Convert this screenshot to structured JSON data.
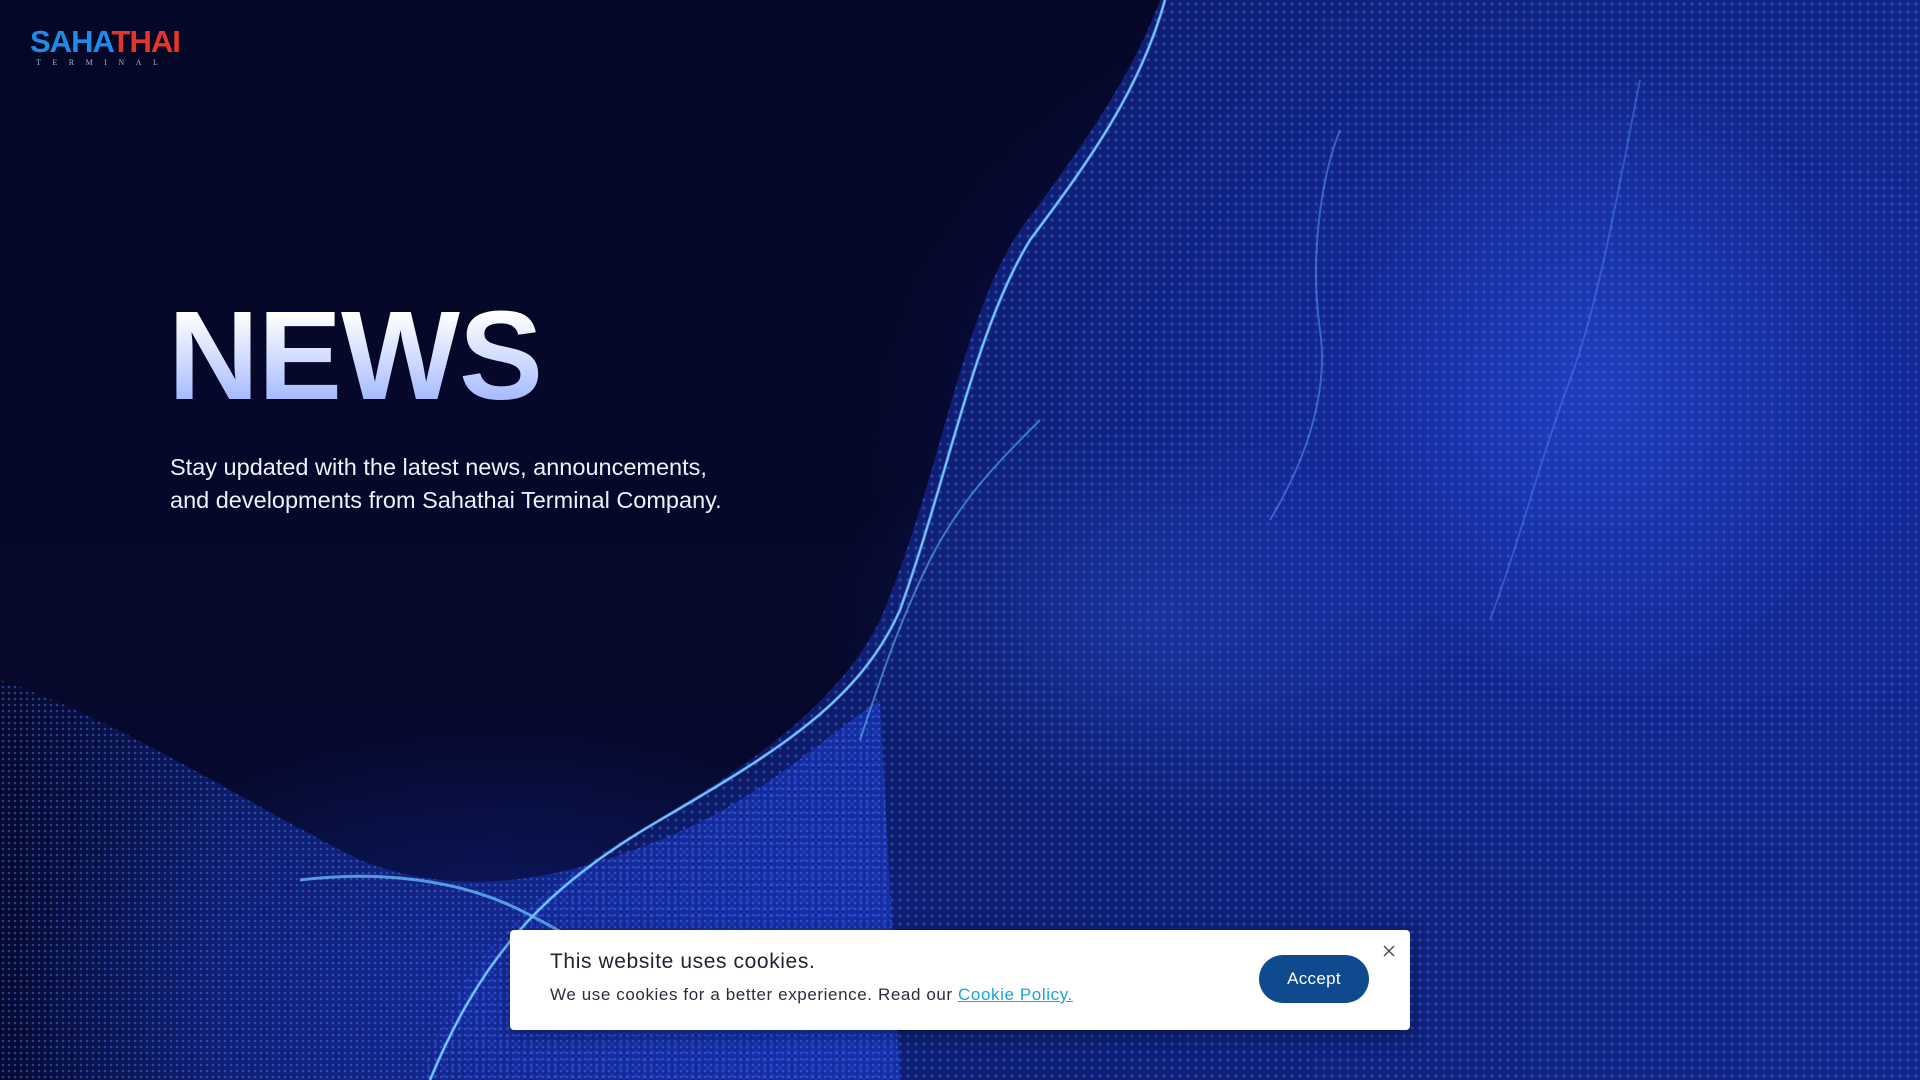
{
  "brand": {
    "logo_part1": "SAHA",
    "logo_part2": "THAI",
    "logo_subtitle": "TERMINAL",
    "color_primary": "#1e8be8",
    "color_accent": "#e8342b"
  },
  "hero": {
    "title": "NEWS",
    "description_line1": "Stay updated with the latest news, announcements,",
    "description_line2": "and developments from Sahathai Terminal Company."
  },
  "cookie_banner": {
    "title": "This website uses cookies.",
    "text": "We use cookies for a better experience. Read our ",
    "link_label": "Cookie Policy.",
    "accept_label": "Accept",
    "accept_color": "#0f4a8f",
    "close_icon": "close-icon"
  },
  "background": {
    "base_color": "#05082a",
    "wave_color": "#2a5cff",
    "highlight_color": "#5fb4ff"
  }
}
